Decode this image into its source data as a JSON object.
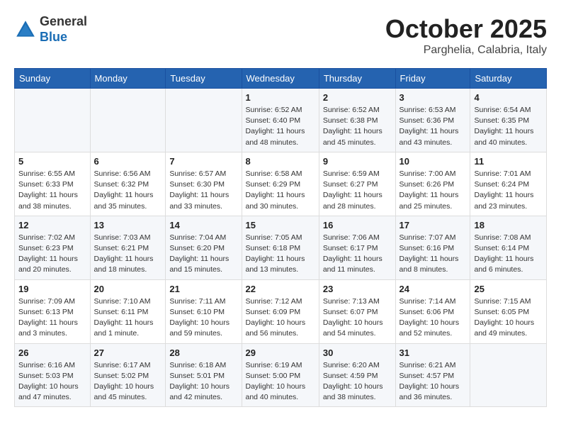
{
  "header": {
    "logo_general": "General",
    "logo_blue": "Blue",
    "month": "October 2025",
    "location": "Parghelia, Calabria, Italy"
  },
  "weekdays": [
    "Sunday",
    "Monday",
    "Tuesday",
    "Wednesday",
    "Thursday",
    "Friday",
    "Saturday"
  ],
  "weeks": [
    [
      {
        "day": "",
        "info": ""
      },
      {
        "day": "",
        "info": ""
      },
      {
        "day": "",
        "info": ""
      },
      {
        "day": "1",
        "info": "Sunrise: 6:52 AM\nSunset: 6:40 PM\nDaylight: 11 hours and 48 minutes."
      },
      {
        "day": "2",
        "info": "Sunrise: 6:52 AM\nSunset: 6:38 PM\nDaylight: 11 hours and 45 minutes."
      },
      {
        "day": "3",
        "info": "Sunrise: 6:53 AM\nSunset: 6:36 PM\nDaylight: 11 hours and 43 minutes."
      },
      {
        "day": "4",
        "info": "Sunrise: 6:54 AM\nSunset: 6:35 PM\nDaylight: 11 hours and 40 minutes."
      }
    ],
    [
      {
        "day": "5",
        "info": "Sunrise: 6:55 AM\nSunset: 6:33 PM\nDaylight: 11 hours and 38 minutes."
      },
      {
        "day": "6",
        "info": "Sunrise: 6:56 AM\nSunset: 6:32 PM\nDaylight: 11 hours and 35 minutes."
      },
      {
        "day": "7",
        "info": "Sunrise: 6:57 AM\nSunset: 6:30 PM\nDaylight: 11 hours and 33 minutes."
      },
      {
        "day": "8",
        "info": "Sunrise: 6:58 AM\nSunset: 6:29 PM\nDaylight: 11 hours and 30 minutes."
      },
      {
        "day": "9",
        "info": "Sunrise: 6:59 AM\nSunset: 6:27 PM\nDaylight: 11 hours and 28 minutes."
      },
      {
        "day": "10",
        "info": "Sunrise: 7:00 AM\nSunset: 6:26 PM\nDaylight: 11 hours and 25 minutes."
      },
      {
        "day": "11",
        "info": "Sunrise: 7:01 AM\nSunset: 6:24 PM\nDaylight: 11 hours and 23 minutes."
      }
    ],
    [
      {
        "day": "12",
        "info": "Sunrise: 7:02 AM\nSunset: 6:23 PM\nDaylight: 11 hours and 20 minutes."
      },
      {
        "day": "13",
        "info": "Sunrise: 7:03 AM\nSunset: 6:21 PM\nDaylight: 11 hours and 18 minutes."
      },
      {
        "day": "14",
        "info": "Sunrise: 7:04 AM\nSunset: 6:20 PM\nDaylight: 11 hours and 15 minutes."
      },
      {
        "day": "15",
        "info": "Sunrise: 7:05 AM\nSunset: 6:18 PM\nDaylight: 11 hours and 13 minutes."
      },
      {
        "day": "16",
        "info": "Sunrise: 7:06 AM\nSunset: 6:17 PM\nDaylight: 11 hours and 11 minutes."
      },
      {
        "day": "17",
        "info": "Sunrise: 7:07 AM\nSunset: 6:16 PM\nDaylight: 11 hours and 8 minutes."
      },
      {
        "day": "18",
        "info": "Sunrise: 7:08 AM\nSunset: 6:14 PM\nDaylight: 11 hours and 6 minutes."
      }
    ],
    [
      {
        "day": "19",
        "info": "Sunrise: 7:09 AM\nSunset: 6:13 PM\nDaylight: 11 hours and 3 minutes."
      },
      {
        "day": "20",
        "info": "Sunrise: 7:10 AM\nSunset: 6:11 PM\nDaylight: 11 hours and 1 minute."
      },
      {
        "day": "21",
        "info": "Sunrise: 7:11 AM\nSunset: 6:10 PM\nDaylight: 10 hours and 59 minutes."
      },
      {
        "day": "22",
        "info": "Sunrise: 7:12 AM\nSunset: 6:09 PM\nDaylight: 10 hours and 56 minutes."
      },
      {
        "day": "23",
        "info": "Sunrise: 7:13 AM\nSunset: 6:07 PM\nDaylight: 10 hours and 54 minutes."
      },
      {
        "day": "24",
        "info": "Sunrise: 7:14 AM\nSunset: 6:06 PM\nDaylight: 10 hours and 52 minutes."
      },
      {
        "day": "25",
        "info": "Sunrise: 7:15 AM\nSunset: 6:05 PM\nDaylight: 10 hours and 49 minutes."
      }
    ],
    [
      {
        "day": "26",
        "info": "Sunrise: 6:16 AM\nSunset: 5:03 PM\nDaylight: 10 hours and 47 minutes."
      },
      {
        "day": "27",
        "info": "Sunrise: 6:17 AM\nSunset: 5:02 PM\nDaylight: 10 hours and 45 minutes."
      },
      {
        "day": "28",
        "info": "Sunrise: 6:18 AM\nSunset: 5:01 PM\nDaylight: 10 hours and 42 minutes."
      },
      {
        "day": "29",
        "info": "Sunrise: 6:19 AM\nSunset: 5:00 PM\nDaylight: 10 hours and 40 minutes."
      },
      {
        "day": "30",
        "info": "Sunrise: 6:20 AM\nSunset: 4:59 PM\nDaylight: 10 hours and 38 minutes."
      },
      {
        "day": "31",
        "info": "Sunrise: 6:21 AM\nSunset: 4:57 PM\nDaylight: 10 hours and 36 minutes."
      },
      {
        "day": "",
        "info": ""
      }
    ]
  ]
}
